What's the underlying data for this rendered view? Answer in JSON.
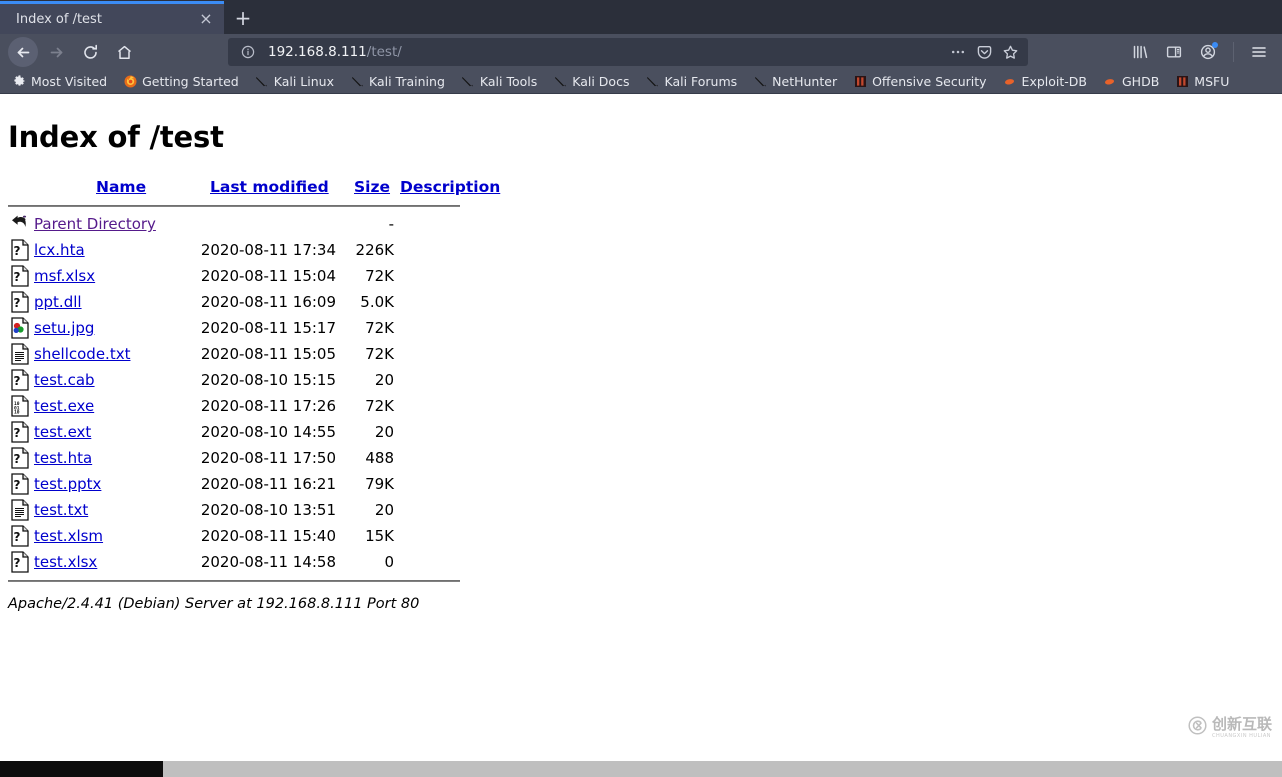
{
  "browser": {
    "tab": {
      "title": "Index of /test",
      "close_label": "×"
    },
    "new_tab_label": "+",
    "nav": {
      "back": "back-button",
      "forward": "forward-button",
      "reload": "reload-button",
      "home": "home-button"
    },
    "url": {
      "host": "192.168.8.111",
      "path": "/test/"
    },
    "bookmarks": [
      {
        "label": "Most Visited",
        "icon": "gear-icon"
      },
      {
        "label": "Getting Started",
        "icon": "firefox-icon"
      },
      {
        "label": "Kali Linux",
        "icon": "kali-dragon-icon"
      },
      {
        "label": "Kali Training",
        "icon": "kali-dragon-icon"
      },
      {
        "label": "Kali Tools",
        "icon": "kali-dragon-icon"
      },
      {
        "label": "Kali Docs",
        "icon": "kali-dragon-icon"
      },
      {
        "label": "Kali Forums",
        "icon": "kali-dragon-icon"
      },
      {
        "label": "NetHunter",
        "icon": "kali-dragon-icon"
      },
      {
        "label": "Offensive Security",
        "icon": "offsec-icon"
      },
      {
        "label": "Exploit-DB",
        "icon": "exploitdb-icon"
      },
      {
        "label": "GHDB",
        "icon": "ghdb-icon"
      },
      {
        "label": "MSFU",
        "icon": "msfu-icon"
      }
    ]
  },
  "page": {
    "heading": "Index of /test",
    "columns": [
      "Name",
      "Last modified",
      "Size",
      "Description"
    ],
    "parent": {
      "icon": "parent-directory-icon",
      "name": "Parent Directory",
      "modified": "",
      "size": "-",
      "description": ""
    },
    "rows": [
      {
        "icon": "unknown-file-icon",
        "name": "lcx.hta",
        "modified": "2020-08-11 17:34",
        "size": "226K",
        "description": ""
      },
      {
        "icon": "unknown-file-icon",
        "name": "msf.xlsx",
        "modified": "2020-08-11 15:04",
        "size": "72K",
        "description": ""
      },
      {
        "icon": "unknown-file-icon",
        "name": "ppt.dll",
        "modified": "2020-08-11 16:09",
        "size": "5.0K",
        "description": ""
      },
      {
        "icon": "image-file-icon",
        "name": "setu.jpg",
        "modified": "2020-08-11 15:17",
        "size": "72K",
        "description": ""
      },
      {
        "icon": "text-file-icon",
        "name": "shellcode.txt",
        "modified": "2020-08-11 15:05",
        "size": "72K",
        "description": ""
      },
      {
        "icon": "unknown-file-icon",
        "name": "test.cab",
        "modified": "2020-08-10 15:15",
        "size": "20",
        "description": ""
      },
      {
        "icon": "binary-file-icon",
        "name": "test.exe",
        "modified": "2020-08-11 17:26",
        "size": "72K",
        "description": ""
      },
      {
        "icon": "unknown-file-icon",
        "name": "test.ext",
        "modified": "2020-08-10 14:55",
        "size": "20",
        "description": ""
      },
      {
        "icon": "unknown-file-icon",
        "name": "test.hta",
        "modified": "2020-08-11 17:50",
        "size": "488",
        "description": ""
      },
      {
        "icon": "unknown-file-icon",
        "name": "test.pptx",
        "modified": "2020-08-11 16:21",
        "size": "79K",
        "description": ""
      },
      {
        "icon": "text-file-icon",
        "name": "test.txt",
        "modified": "2020-08-10 13:51",
        "size": "20",
        "description": ""
      },
      {
        "icon": "unknown-file-icon",
        "name": "test.xlsm",
        "modified": "2020-08-11 15:40",
        "size": "15K",
        "description": ""
      },
      {
        "icon": "unknown-file-icon",
        "name": "test.xlsx",
        "modified": "2020-08-11 14:58",
        "size": "0",
        "description": ""
      }
    ],
    "server_signature": "Apache/2.4.41 (Debian) Server at 192.168.8.111 Port 80"
  },
  "watermark": {
    "cn": "创新互联",
    "pinyin": "CHUANGXIN HULIAN"
  },
  "colors": {
    "chrome_bg": "#4a4f5e",
    "tabstrip_bg": "#2b2f3a",
    "active_tab": "#42475a",
    "tab_accent": "#3b8cf5",
    "url_field": "#353a48",
    "link": "#0000cc",
    "visited_link": "#551a8b",
    "page_bg": "#ffffff",
    "scrollbar_track": "#bfbfbf",
    "scrollbar_thumb": "#0d0d0d"
  }
}
